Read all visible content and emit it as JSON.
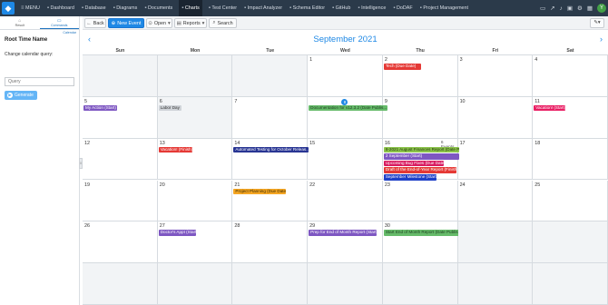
{
  "nav": {
    "menu_label": "MENU",
    "items": [
      {
        "label": "Dashboard",
        "icon": "dashboard-icon"
      },
      {
        "label": "Database",
        "icon": "database-icon"
      },
      {
        "label": "Diagrams",
        "icon": "diagram-icon"
      },
      {
        "label": "Documents",
        "icon": "document-icon"
      },
      {
        "label": "Charts",
        "icon": "chart-icon",
        "active": true
      },
      {
        "label": "Test Center",
        "icon": "test-icon"
      },
      {
        "label": "Impact Analyzer",
        "icon": "impact-icon"
      },
      {
        "label": "Schema Editor",
        "icon": "schema-icon"
      },
      {
        "label": "GitHub",
        "icon": "github-icon"
      },
      {
        "label": "Intelligence",
        "icon": "intelligence-icon"
      },
      {
        "label": "DoDAF",
        "icon": "dodaf-icon"
      },
      {
        "label": "Project Management",
        "icon": "project-icon"
      }
    ],
    "avatar_initial": "Y"
  },
  "sidebar": {
    "tabs": [
      {
        "label": "Result"
      },
      {
        "label": "Commands",
        "active": true
      }
    ],
    "sub_link": "Calendar",
    "root_title": "Root Time Name",
    "query_label": "Change calendar query:",
    "query_placeholder": "Query",
    "generate_label": "Generate"
  },
  "toolbar": {
    "back_label": "Back",
    "new_event_label": "New Event",
    "open_label": "Open",
    "reports_label": "Reports",
    "search_label": "Search"
  },
  "calendar": {
    "month_title": "September 2021",
    "weekdays": [
      "Sun",
      "Mon",
      "Tue",
      "Wed",
      "Thu",
      "Fri",
      "Sat"
    ],
    "days": [
      {
        "n": "",
        "off": true
      },
      {
        "n": "",
        "off": true
      },
      {
        "n": "",
        "off": true
      },
      {
        "n": "1"
      },
      {
        "n": "2"
      },
      {
        "n": "3"
      },
      {
        "n": "4"
      },
      {
        "n": "5"
      },
      {
        "n": "6",
        "off": true
      },
      {
        "n": "7"
      },
      {
        "n": "8",
        "today": true
      },
      {
        "n": "9"
      },
      {
        "n": "10"
      },
      {
        "n": "11"
      },
      {
        "n": "12"
      },
      {
        "n": "13"
      },
      {
        "n": "14"
      },
      {
        "n": "15"
      },
      {
        "n": "16"
      },
      {
        "n": "17"
      },
      {
        "n": "18"
      },
      {
        "n": "19"
      },
      {
        "n": "20"
      },
      {
        "n": "21"
      },
      {
        "n": "22"
      },
      {
        "n": "23"
      },
      {
        "n": "24"
      },
      {
        "n": "25"
      },
      {
        "n": "26"
      },
      {
        "n": "27"
      },
      {
        "n": "28"
      },
      {
        "n": "29"
      },
      {
        "n": "30"
      },
      {
        "n": "",
        "off": true
      },
      {
        "n": "",
        "off": true
      },
      {
        "n": "",
        "off": true
      },
      {
        "n": "",
        "off": true
      },
      {
        "n": "",
        "off": true
      },
      {
        "n": "",
        "off": true
      },
      {
        "n": "",
        "off": true
      },
      {
        "n": "",
        "off": true
      },
      {
        "n": "",
        "off": true
      }
    ],
    "more_events_label": "6 Events",
    "events": [
      {
        "label": "Tech (Due Date)",
        "color": "red",
        "cell": 4,
        "slot": 0,
        "span": 0.5
      },
      {
        "label": "My Action (Start)",
        "color": "purple",
        "cell": 7,
        "slot": 0,
        "span": 0.45
      },
      {
        "label": "Labor Day",
        "color": "gray",
        "cell": 8,
        "slot": 0,
        "span": 0.3
      },
      {
        "label": "Documentation for v12.3.2 (Date Publis...",
        "color": "green",
        "cell": 10,
        "slot": 0,
        "span": 1.05
      },
      {
        "label": "Vacation! (Start)",
        "color": "pink",
        "cell": 13,
        "slot": 0,
        "span": 0.42
      },
      {
        "label": "Vacation! (Finish)",
        "color": "red",
        "cell": 15,
        "slot": 0,
        "span": 0.45
      },
      {
        "label": "Automated Testing for October Releas...",
        "color": "navy",
        "cell": 16,
        "slot": 0,
        "span": 1.0
      },
      {
        "label": "8-2021 August Finances Report (Date P...",
        "color": "olive",
        "cell": 18,
        "slot": 0,
        "span": 1.0
      },
      {
        "label": "2 September (Start)",
        "color": "purple",
        "cell": 18,
        "slot": 1,
        "span": 1.0
      },
      {
        "label": "Upcoming Bug Fixes (Due Date)",
        "color": "magenta",
        "cell": 18,
        "slot": 2,
        "span": 0.8
      },
      {
        "label": "Draft of the End-of-Year Report (Finish)",
        "color": "red",
        "cell": 18,
        "slot": 3,
        "span": 0.97
      },
      {
        "label": "September Milestone (Start)",
        "color": "blue",
        "cell": 18,
        "slot": 4,
        "span": 0.7
      },
      {
        "label": "Project Planning (Due Date)",
        "color": "orange",
        "cell": 23,
        "slot": 0,
        "span": 0.7
      },
      {
        "label": "Doctor's Appt (Start)",
        "color": "purple",
        "cell": 29,
        "slot": 0,
        "span": 0.5
      },
      {
        "label": "Prep for End of Month Report (Start)",
        "color": "purple",
        "cell": 31,
        "slot": 0,
        "span": 0.9
      },
      {
        "label": "Start End of Month Report (Date Publis...",
        "color": "green",
        "cell": 32,
        "slot": 0,
        "span": 1.0
      }
    ]
  }
}
